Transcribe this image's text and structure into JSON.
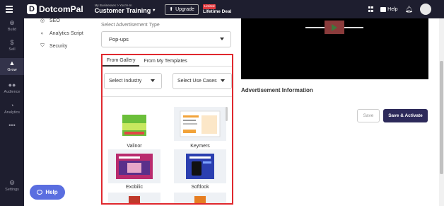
{
  "topbar": {
    "brand": "DotcomPal",
    "business_caption": "My Businesses > You're In",
    "business_name": "Customer Training",
    "upgrade_label": "Upgrade",
    "limited_badge": "Limited",
    "lifetime_deal": "Lifetime Deal",
    "help_label": "Help"
  },
  "leftnav": {
    "items": [
      {
        "label": "Build",
        "icon": "build-icon"
      },
      {
        "label": "Sell",
        "icon": "dollar-icon"
      },
      {
        "label": "Grow",
        "icon": "grow-icon",
        "active": true
      },
      {
        "label": "Audience",
        "icon": "audience-icon"
      },
      {
        "label": "Analytics",
        "icon": "analytics-icon"
      },
      {
        "label": "•••",
        "icon": "more-icon"
      },
      {
        "label": "Settings",
        "icon": "gear-icon"
      }
    ]
  },
  "settings_list": {
    "items": [
      {
        "label": "SEO",
        "icon": "seo-icon"
      },
      {
        "label": "Analytics Script",
        "icon": "analytics-script-icon"
      },
      {
        "label": "Security",
        "icon": "shield-icon"
      }
    ]
  },
  "ad_type": {
    "label": "Select Advertisement Type",
    "value": "Pop-ups"
  },
  "templates": {
    "tabs": [
      {
        "label": "From Gallery",
        "active": true
      },
      {
        "label": "From My Templates",
        "active": false
      }
    ],
    "industry_filter": "Select Industry",
    "use_case_filter": "Select Use Cases",
    "items": [
      {
        "name": "Valinor"
      },
      {
        "name": "Keymers"
      },
      {
        "name": "Exobilic"
      },
      {
        "name": "Softlook"
      }
    ]
  },
  "right": {
    "ad_info_title": "Advertisement Information",
    "save_label": "Save",
    "save_activate_label": "Save & Activate"
  },
  "help_float": {
    "label": "Help"
  }
}
